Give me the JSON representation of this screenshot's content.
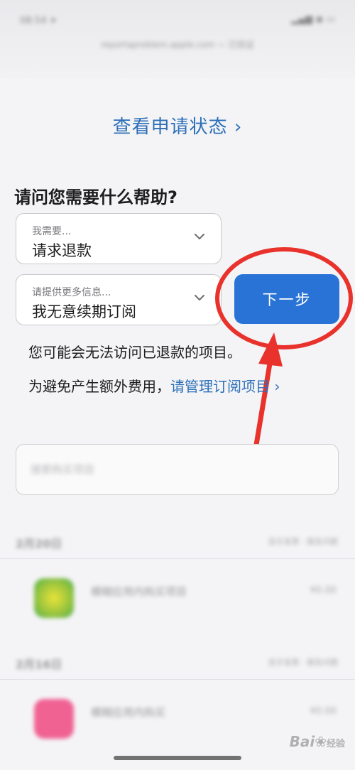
{
  "status_bar": {
    "time": "08:54 ✈",
    "icons": "▂▄▆ ◉ ▭"
  },
  "browser": {
    "url": "reportaproblem.apple.com — 已验证"
  },
  "check_status_link": "查看申请状态 ›",
  "help_title": "请问您需要什么帮助?",
  "select_need": {
    "label": "我需要...",
    "value": "请求退款"
  },
  "select_more_info": {
    "label": "请提供更多信息...",
    "value": "我无意续期订阅"
  },
  "next_button": "下一步",
  "info_text_1": "您可能会无法访问已退款的项目。",
  "info_text_2_prefix": "为避免产生额外费用，",
  "manage_subscriptions_link": "请管理订阅项目 ›",
  "search": {
    "placeholder": "搜索购买项目"
  },
  "purchases": [
    {
      "date": "2月20日",
      "action": "显示发票 · 报告问题",
      "name": "模糊应用内购买项目",
      "price": "¥0.00",
      "icon_color": "#9bc53d"
    },
    {
      "date": "2月16日",
      "action": "显示发票 · 报告问题",
      "name": "模糊应用内购买",
      "price": "¥0.00",
      "icon_color": "#f06292"
    }
  ],
  "watermark": {
    "logo": "Bai",
    "paw": "❀",
    "suffix": "经验"
  },
  "colors": {
    "accent": "#2a73d6",
    "link": "#2c6fb8",
    "annotation_red": "#e8322b"
  }
}
